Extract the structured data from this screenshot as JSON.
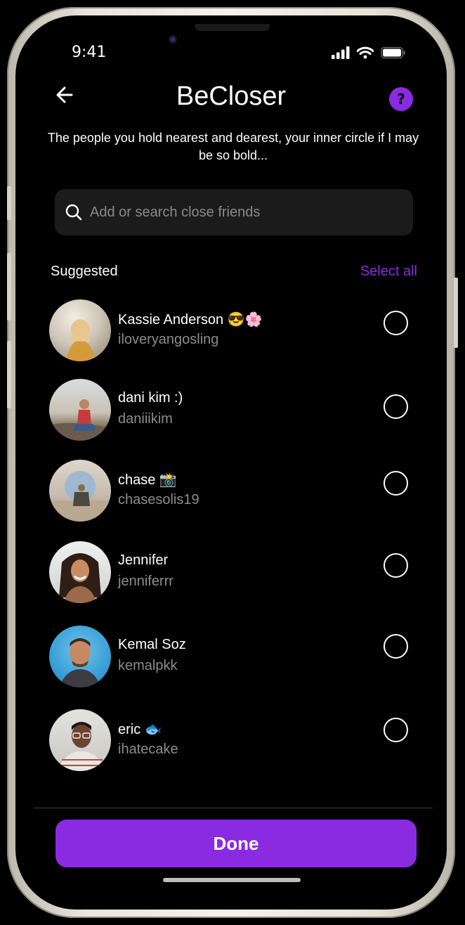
{
  "status_bar": {
    "time": "9:41"
  },
  "header": {
    "title": "BeCloser",
    "help_label": "?"
  },
  "subtitle": "The people you hold nearest and dearest, your inner circle if I may be so bold...",
  "search": {
    "placeholder": "Add or search close friends",
    "value": ""
  },
  "section": {
    "title": "Suggested",
    "select_all_label": "Select all"
  },
  "friends": [
    {
      "name": "Kassie Anderson 😎🌸",
      "handle": "iloveryangosling",
      "selected": false
    },
    {
      "name": "dani kim :)",
      "handle": "daniiikim",
      "selected": false
    },
    {
      "name": "chase 📸",
      "handle": "chasesolis19",
      "selected": false
    },
    {
      "name": "Jennifer",
      "handle": "jenniferrr",
      "selected": false
    },
    {
      "name": "Kemal Soz",
      "handle": "kemalpkk",
      "selected": false
    },
    {
      "name": "eric 🐟",
      "handle": "ihatecake",
      "selected": false
    }
  ],
  "done_label": "Done",
  "colors": {
    "accent": "#8a2be2",
    "background": "#000000",
    "muted_text": "#8c8c8c",
    "search_bg": "#1b1b1b"
  }
}
